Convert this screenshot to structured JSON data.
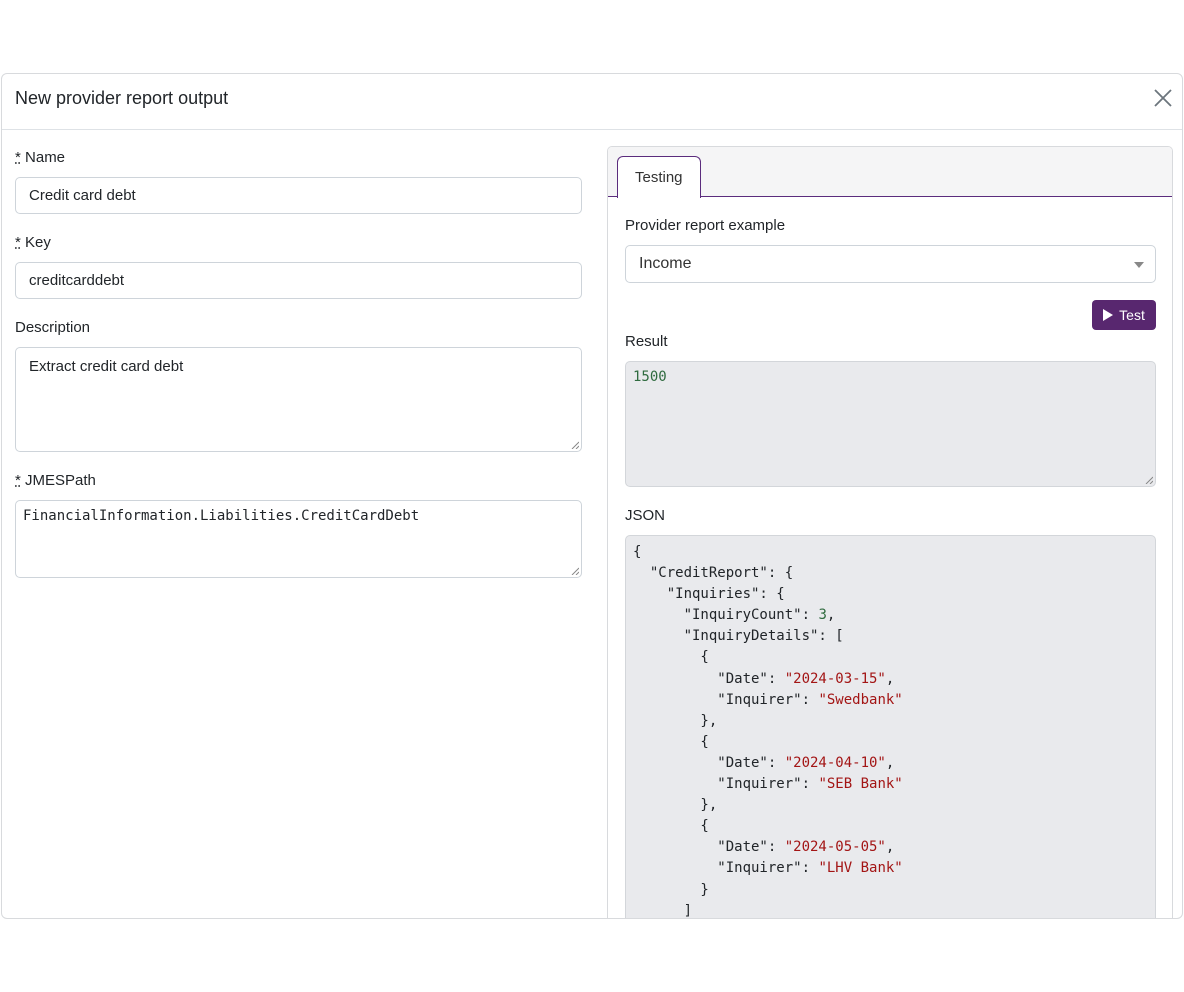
{
  "modal": {
    "title": "New provider report output"
  },
  "form": {
    "name": {
      "required_mark": "*",
      "label": "Name",
      "value": "Credit card debt"
    },
    "key": {
      "required_mark": "*",
      "label": "Key",
      "value": "creditcarddebt"
    },
    "description": {
      "label": "Description",
      "value": "Extract credit card debt"
    },
    "jmespath": {
      "required_mark": "*",
      "label": "JMESPath",
      "value": "FinancialInformation.Liabilities.CreditCardDebt"
    }
  },
  "testing": {
    "tab_label": "Testing",
    "example_label": "Provider report example",
    "example_selected": "Income",
    "test_button_label": "Test",
    "result_label": "Result",
    "result_value": "1500",
    "json_label": "JSON",
    "json_lines": [
      [
        {
          "t": "p",
          "v": "{"
        }
      ],
      [
        {
          "t": "p",
          "v": "  \"CreditReport\": {"
        }
      ],
      [
        {
          "t": "p",
          "v": "    \"Inquiries\": {"
        }
      ],
      [
        {
          "t": "p",
          "v": "      \"InquiryCount\": "
        },
        {
          "t": "n",
          "v": "3"
        },
        {
          "t": "p",
          "v": ","
        }
      ],
      [
        {
          "t": "p",
          "v": "      \"InquiryDetails\": ["
        }
      ],
      [
        {
          "t": "p",
          "v": "        {"
        }
      ],
      [
        {
          "t": "p",
          "v": "          \"Date\": "
        },
        {
          "t": "s",
          "v": "\"2024-03-15\""
        },
        {
          "t": "p",
          "v": ","
        }
      ],
      [
        {
          "t": "p",
          "v": "          \"Inquirer\": "
        },
        {
          "t": "s",
          "v": "\"Swedbank\""
        }
      ],
      [
        {
          "t": "p",
          "v": "        },"
        }
      ],
      [
        {
          "t": "p",
          "v": "        {"
        }
      ],
      [
        {
          "t": "p",
          "v": "          \"Date\": "
        },
        {
          "t": "s",
          "v": "\"2024-04-10\""
        },
        {
          "t": "p",
          "v": ","
        }
      ],
      [
        {
          "t": "p",
          "v": "          \"Inquirer\": "
        },
        {
          "t": "s",
          "v": "\"SEB Bank\""
        }
      ],
      [
        {
          "t": "p",
          "v": "        },"
        }
      ],
      [
        {
          "t": "p",
          "v": "        {"
        }
      ],
      [
        {
          "t": "p",
          "v": "          \"Date\": "
        },
        {
          "t": "s",
          "v": "\"2024-05-05\""
        },
        {
          "t": "p",
          "v": ","
        }
      ],
      [
        {
          "t": "p",
          "v": "          \"Inquirer\": "
        },
        {
          "t": "s",
          "v": "\"LHV Bank\""
        }
      ],
      [
        {
          "t": "p",
          "v": "        }"
        }
      ],
      [
        {
          "t": "p",
          "v": "      ]"
        }
      ]
    ]
  },
  "icons": {
    "close": "close-icon",
    "caret": "chevron-down-icon",
    "play": "play-icon"
  },
  "colors": {
    "accent": "#58276f",
    "json_string": "#a31515",
    "json_number": "#2f6b3f"
  }
}
